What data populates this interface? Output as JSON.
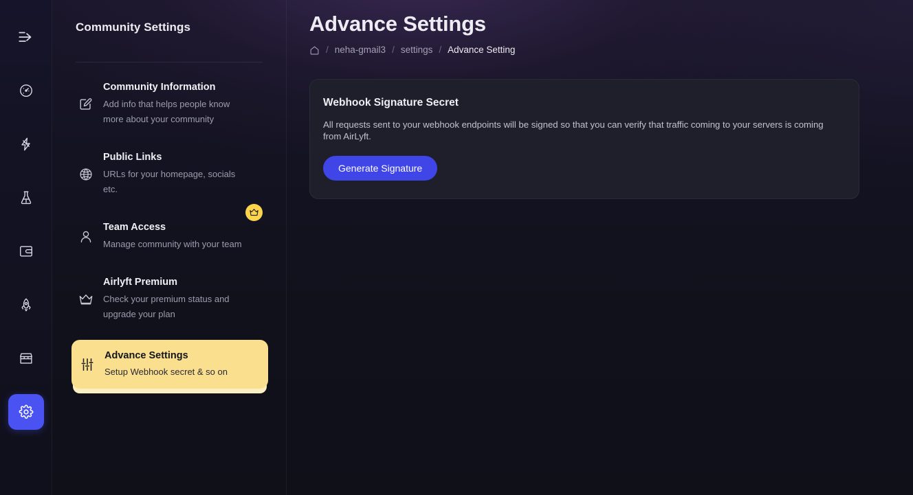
{
  "rail": {
    "items": [
      {
        "icon": "collapse-arrow-icon",
        "name": "collapse-sidebar-button",
        "active": false
      },
      {
        "icon": "dashboard-gauge-icon",
        "name": "rail-item-dashboard",
        "active": false
      },
      {
        "icon": "lightning-bolt-icon",
        "name": "rail-item-activity",
        "active": false
      },
      {
        "icon": "flask-icon",
        "name": "rail-item-lab",
        "active": false
      },
      {
        "icon": "wallet-icon",
        "name": "rail-item-wallet",
        "active": false
      },
      {
        "icon": "rocket-icon",
        "name": "rail-item-launch",
        "active": false
      },
      {
        "icon": "store-icon",
        "name": "rail-item-store",
        "active": false
      },
      {
        "icon": "gear-icon",
        "name": "rail-item-settings",
        "active": true
      }
    ]
  },
  "panel": {
    "title": "Community Settings",
    "items": [
      {
        "icon": "edit-square-icon",
        "title": "Community Information",
        "desc": "Add info that helps people know more about your community",
        "badge": null,
        "active": false
      },
      {
        "icon": "globe-icon",
        "title": "Public Links",
        "desc": "URLs for your homepage, socials etc.",
        "badge": null,
        "active": false
      },
      {
        "icon": "user-icon",
        "title": "Team Access",
        "desc": "Manage community with your team",
        "badge": "crown-badge-icon",
        "active": false
      },
      {
        "icon": "crown-icon",
        "title": "Airlyft Premium",
        "desc": "Check your premium status and upgrade your plan",
        "badge": null,
        "active": false
      },
      {
        "icon": "sliders-icon",
        "title": "Advance Settings",
        "desc": "Setup Webhook secret & so on",
        "badge": null,
        "active": true
      }
    ]
  },
  "main": {
    "page_title": "Advance Settings",
    "breadcrumb": {
      "home_icon": "home-icon",
      "separator": "/",
      "items": [
        {
          "label": "neha-gmail3",
          "current": false
        },
        {
          "label": "settings",
          "current": false
        },
        {
          "label": "Advance Setting",
          "current": true
        }
      ]
    },
    "card": {
      "title": "Webhook Signature Secret",
      "description": "All requests sent to your webhook endpoints will be signed so that you can verify that traffic coming to your servers is coming from AirLyft.",
      "button_label": "Generate Signature"
    }
  },
  "colors": {
    "accent_blue": "#3f45e6",
    "rail_active_blue": "#4a53f2",
    "highlight_yellow": "#f9df8e",
    "badge_yellow": "#fbd34d",
    "page_background": "#11111c",
    "card_background": "#1f1f2c"
  }
}
